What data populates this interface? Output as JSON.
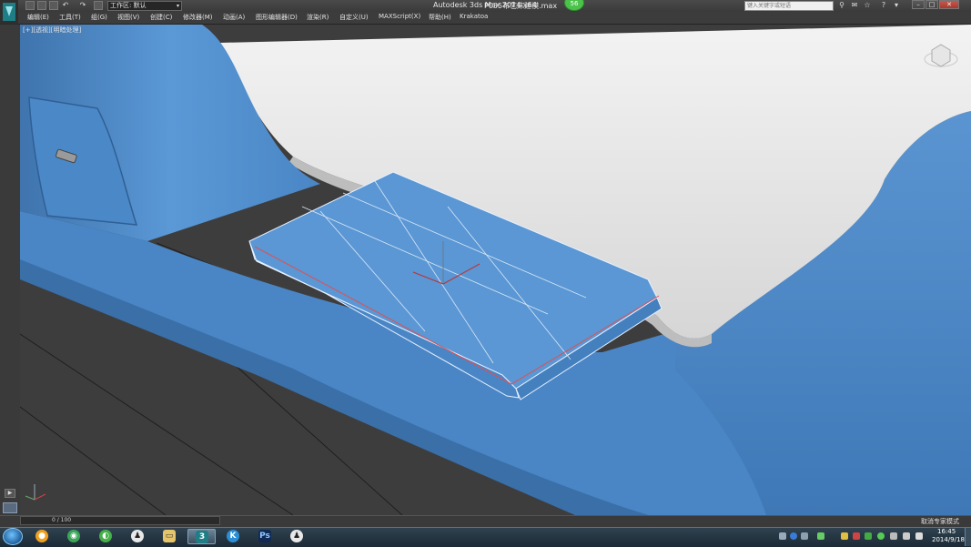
{
  "titlebar": {
    "workspace_label": "工作区: 默认",
    "app_title": "Autodesk 3ds Max  2014 x64",
    "file_title": "P035布艺床建模.max",
    "badge": "56",
    "search_placeholder": "键入关键字或短语"
  },
  "menubar": {
    "items": [
      "编辑(E)",
      "工具(T)",
      "组(G)",
      "视图(V)",
      "创建(C)",
      "修改器(M)",
      "动画(A)",
      "图形编辑器(D)",
      "渲染(R)",
      "自定义(U)",
      "MAXScript(X)",
      "帮助(H)",
      "Krakatoa"
    ]
  },
  "viewport": {
    "label": "[+][透视][明暗处理]"
  },
  "timeline": {
    "label": "0 / 100"
  },
  "statusbar": {
    "mode_text": "取消专家模式"
  },
  "taskbar": {
    "time": "16:45",
    "date": "2014/9/18"
  },
  "colors": {
    "model_blue": "#4a86c5",
    "mattress_white": "#e8e8e8",
    "floor_gray": "#3c3c3c"
  }
}
